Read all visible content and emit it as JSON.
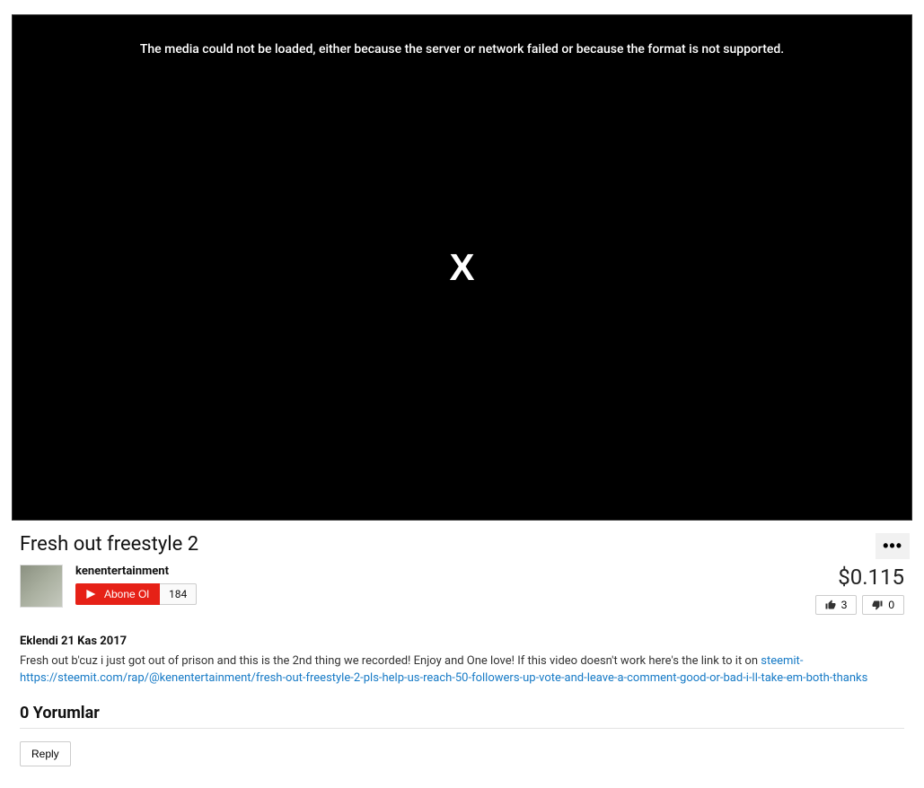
{
  "player": {
    "errorMessage": "The media could not be loaded, either because the server or network failed or because the format is not supported.",
    "errorSymbol": "X"
  },
  "video": {
    "title": "Fresh out freestyle 2",
    "dateAdded": "Eklendi 21 Kas 2017",
    "descriptionPrefix": "Fresh out b'cuz i just got out of prison and this is the 2nd thing we recorded! Enjoy and One love! If this video doesn't work here's the link to it on ",
    "descriptionLink": "steemit- https://steemit.com/rap/@kenentertainment/fresh-out-freestyle-2-pls-help-us-reach-50-followers-up-vote-and-leave-a-comment-good-or-bad-i-ll-take-em-both-thanks"
  },
  "channel": {
    "name": "kenentertainment",
    "subscribeLabel": "Abone Ol",
    "subscriberCount": "184"
  },
  "stats": {
    "price": "$0.115",
    "likes": "3",
    "dislikes": "0"
  },
  "comments": {
    "title": "0 Yorumlar",
    "replyLabel": "Reply"
  },
  "menu": {
    "moreDots": "•••"
  }
}
